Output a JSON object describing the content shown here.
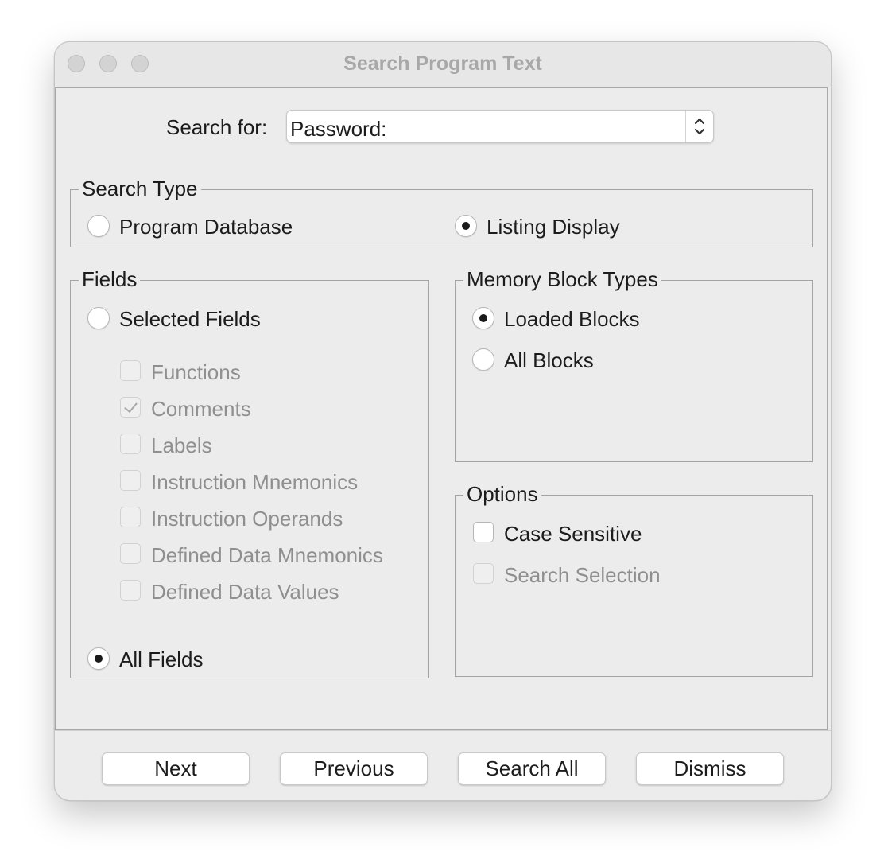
{
  "window": {
    "title": "Search Program Text"
  },
  "search": {
    "label": "Search for:",
    "value": "Password:"
  },
  "search_type": {
    "legend": "Search Type",
    "options": [
      {
        "label": "Program Database",
        "selected": false
      },
      {
        "label": "Listing Display",
        "selected": true
      }
    ]
  },
  "fields": {
    "legend": "Fields",
    "selected_fields_label": "Selected Fields",
    "selected_fields_selected": false,
    "checkboxes": [
      {
        "label": "Functions",
        "checked": false,
        "enabled": false
      },
      {
        "label": "Comments",
        "checked": true,
        "enabled": false
      },
      {
        "label": "Labels",
        "checked": false,
        "enabled": false
      },
      {
        "label": "Instruction Mnemonics",
        "checked": false,
        "enabled": false
      },
      {
        "label": "Instruction Operands",
        "checked": false,
        "enabled": false
      },
      {
        "label": "Defined Data Mnemonics",
        "checked": false,
        "enabled": false
      },
      {
        "label": "Defined Data Values",
        "checked": false,
        "enabled": false
      }
    ],
    "all_fields_label": "All Fields",
    "all_fields_selected": true
  },
  "memory_block_types": {
    "legend": "Memory Block Types",
    "options": [
      {
        "label": "Loaded Blocks",
        "selected": true
      },
      {
        "label": "All Blocks",
        "selected": false
      }
    ]
  },
  "options": {
    "legend": "Options",
    "case_sensitive": {
      "label": "Case Sensitive",
      "checked": false,
      "enabled": true
    },
    "search_selection": {
      "label": "Search Selection",
      "checked": false,
      "enabled": false
    }
  },
  "buttons": {
    "next": "Next",
    "previous": "Previous",
    "search_all": "Search All",
    "dismiss": "Dismiss"
  }
}
